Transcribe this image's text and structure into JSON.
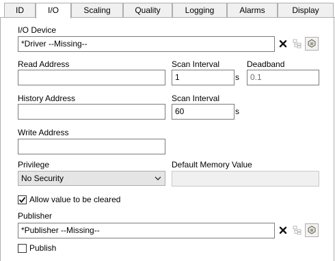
{
  "tabs": [
    {
      "label": "ID"
    },
    {
      "label": "I/O"
    },
    {
      "label": "Scaling"
    },
    {
      "label": "Quality"
    },
    {
      "label": "Logging"
    },
    {
      "label": "Alarms"
    },
    {
      "label": "Display"
    }
  ],
  "active_tab": "I/O",
  "io_device": {
    "label": "I/O Device",
    "value": "*Driver    --Missing--"
  },
  "read_address": {
    "label": "Read Address",
    "value": ""
  },
  "read_scan_interval": {
    "label": "Scan Interval",
    "value": "1",
    "unit": "s"
  },
  "deadband": {
    "label": "Deadband",
    "value": "0.1"
  },
  "history_address": {
    "label": "History Address",
    "value": ""
  },
  "history_scan_interval": {
    "label": "Scan Interval",
    "value": "60",
    "unit": "s"
  },
  "write_address": {
    "label": "Write Address",
    "value": ""
  },
  "privilege": {
    "label": "Privilege",
    "value": "No Security"
  },
  "default_memory_value": {
    "label": "Default Memory Value",
    "value": ""
  },
  "allow_cleared": {
    "label": "Allow value to be cleared",
    "checked": true
  },
  "publisher": {
    "label": "Publisher",
    "value": "*Publisher    --Missing--"
  },
  "publish": {
    "label": "Publish",
    "checked": false
  },
  "icons": {
    "clear": "close-icon",
    "tree": "tree-icon",
    "browse": "tag-browse-icon",
    "dropdown": "chevron-down-icon",
    "check": "checkmark-icon"
  }
}
